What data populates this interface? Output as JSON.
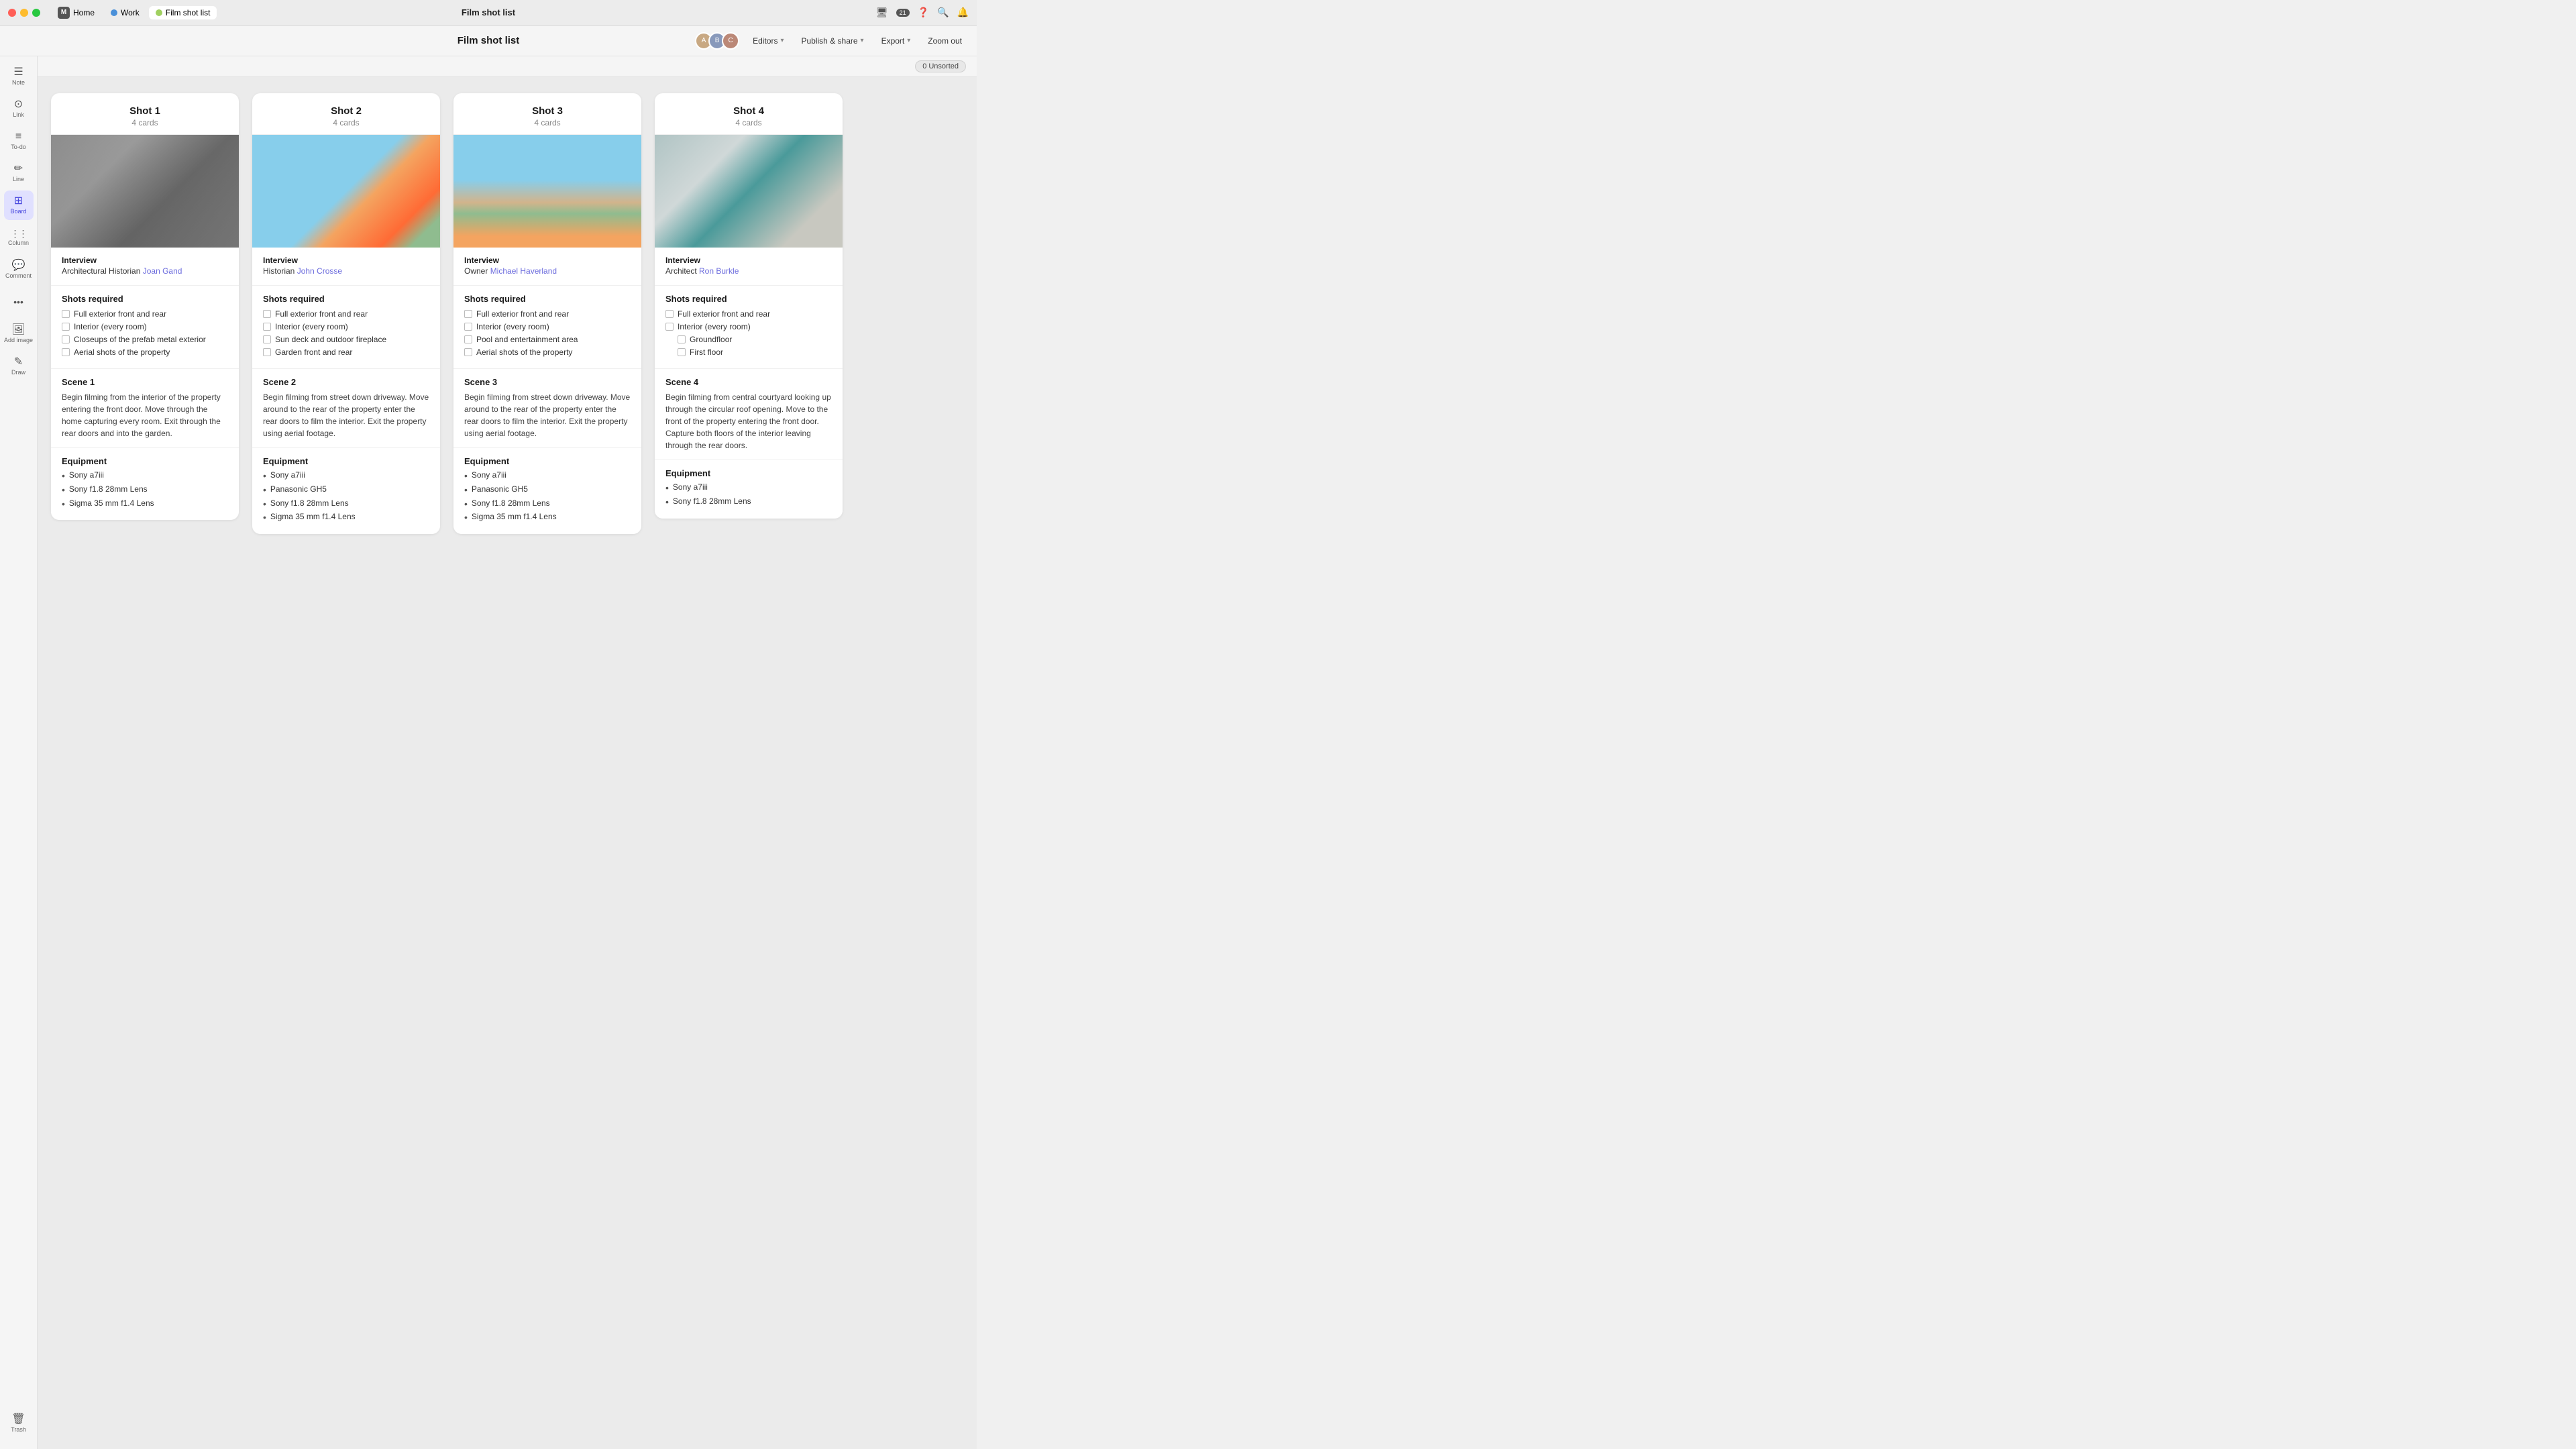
{
  "titlebar": {
    "title": "Film shot list",
    "tabs": [
      {
        "id": "home",
        "label": "Home",
        "icon": "M",
        "type": "initial"
      },
      {
        "id": "work",
        "label": "Work",
        "dot_color": "#4a90d9",
        "active": false
      },
      {
        "id": "filmshot",
        "label": "Film shot list",
        "dot_color": "#a0d060",
        "active": true
      }
    ],
    "notification_count": "21"
  },
  "toolbar": {
    "title": "Film shot list",
    "editors_label": "Editors",
    "publish_share_label": "Publish & share",
    "export_label": "Export",
    "zoom_out_label": "Zoom out"
  },
  "sidebar": {
    "items": [
      {
        "id": "note",
        "icon": "☰",
        "label": "Note"
      },
      {
        "id": "link",
        "icon": "🔗",
        "label": "Link"
      },
      {
        "id": "todo",
        "icon": "☑",
        "label": "To-do"
      },
      {
        "id": "line",
        "icon": "✏",
        "label": "Line"
      },
      {
        "id": "board",
        "icon": "⊞",
        "label": "Board",
        "active": true
      },
      {
        "id": "column",
        "icon": "⋮⋮",
        "label": "Column"
      },
      {
        "id": "comment",
        "icon": "💬",
        "label": "Comment"
      },
      {
        "id": "more",
        "icon": "•••",
        "label": ""
      },
      {
        "id": "addimage",
        "icon": "🖼",
        "label": "Add image"
      },
      {
        "id": "draw",
        "icon": "✏",
        "label": "Draw"
      }
    ],
    "trash_label": "Trash"
  },
  "unsorted": {
    "label": "0 Unsorted"
  },
  "columns": [
    {
      "id": "shot1",
      "title": "Shot 1",
      "count": "4 cards",
      "image_style": "bw",
      "interview_role": "Interview",
      "interview_detail": "Architectural Historian",
      "interview_name": "Joan Gand",
      "shots_required_title": "Shots required",
      "shots": [
        {
          "text": "Full exterior front and rear",
          "sub": false
        },
        {
          "text": "Interior (every room)",
          "sub": false
        },
        {
          "text": "Closeups of the prefab metal exterior",
          "sub": false
        },
        {
          "text": "Aerial shots of the property",
          "sub": false
        }
      ],
      "scene_title": "Scene 1",
      "scene_text": "Begin filming from the interior of the property entering the front door. Move through the home capturing every room. Exit through the rear doors and into the garden.",
      "equipment_title": "Equipment",
      "equipment": [
        "Sony a7iii",
        "Sony f1.8 28mm Lens",
        "Sigma 35 mm f1.4 Lens"
      ]
    },
    {
      "id": "shot2",
      "title": "Shot 2",
      "count": "4 cards",
      "image_style": "orange",
      "interview_role": "Interview",
      "interview_detail": "Historian",
      "interview_name": "John Crosse",
      "shots_required_title": "Shots required",
      "shots": [
        {
          "text": "Full exterior front and rear",
          "sub": false
        },
        {
          "text": "Interior (every room)",
          "sub": false
        },
        {
          "text": "Sun deck and outdoor fireplace",
          "sub": false
        },
        {
          "text": "Garden front and rear",
          "sub": false
        }
      ],
      "scene_title": "Scene 2",
      "scene_text": "Begin filming from street down driveway. Move around to the rear of the property enter the rear doors to film the interior. Exit the property using aerial footage.",
      "equipment_title": "Equipment",
      "equipment": [
        "Sony a7iii",
        "Panasonic GH5",
        "Sony f1.8 28mm Lens",
        "Sigma 35 mm f1.4 Lens"
      ]
    },
    {
      "id": "shot3",
      "title": "Shot 3",
      "count": "4 cards",
      "image_style": "palms",
      "interview_role": "Interview",
      "interview_detail": "Owner",
      "interview_name": "Michael Haverland",
      "shots_required_title": "Shots required",
      "shots": [
        {
          "text": "Full exterior front and rear",
          "sub": false
        },
        {
          "text": "Interior (every room)",
          "sub": false
        },
        {
          "text": "Pool and entertainment area",
          "sub": false
        },
        {
          "text": "Aerial shots of the property",
          "sub": false
        }
      ],
      "scene_title": "Scene 3",
      "scene_text": "Begin filming from street down driveway. Move around to the rear of the property enter the rear doors to film the interior. Exit the property using aerial footage.",
      "equipment_title": "Equipment",
      "equipment": [
        "Sony a7iii",
        "Panasonic GH5",
        "Sony f1.8 28mm Lens",
        "Sigma 35 mm f1.4 Lens"
      ]
    },
    {
      "id": "shot4",
      "title": "Shot 4",
      "count": "4 cards",
      "image_style": "teal",
      "interview_role": "Interview",
      "interview_detail": "Architect",
      "interview_name": "Ron Burkle",
      "shots_required_title": "Shots required",
      "shots": [
        {
          "text": "Full exterior front and rear",
          "sub": false
        },
        {
          "text": "Interior (every room)",
          "sub": false
        },
        {
          "text": "Groundfloor",
          "sub": true
        },
        {
          "text": "First floor",
          "sub": true
        }
      ],
      "scene_title": "Scene 4",
      "scene_text": "Begin filming from central courtyard looking up through the circular roof opening. Move to the front of the property entering the front door. Capture both floors of the interior leaving through the rear doors.",
      "equipment_title": "Equipment",
      "equipment": [
        "Sony a7iii",
        "Sony f1.8 28mm Lens"
      ]
    }
  ]
}
